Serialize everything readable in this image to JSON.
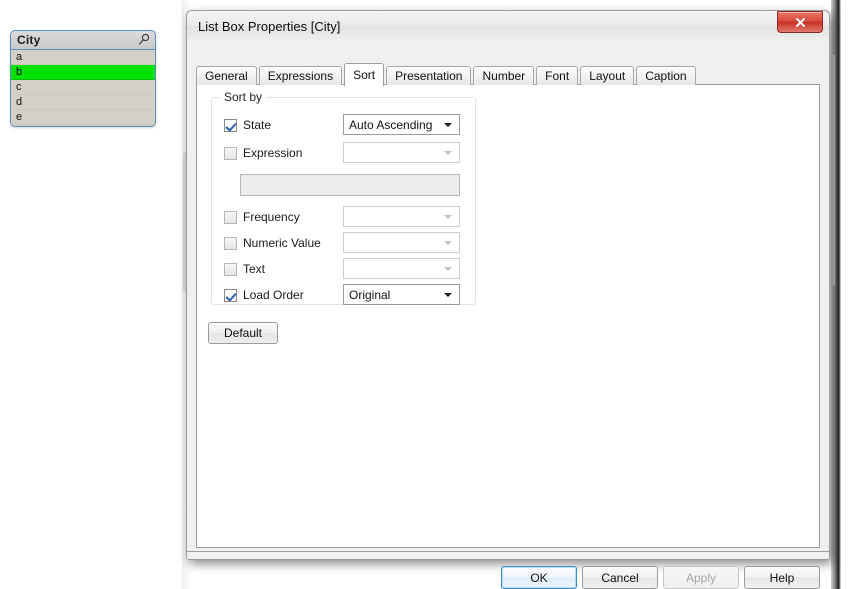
{
  "desktop": {
    "background_color": "#ffffff"
  },
  "listbox_object": {
    "caption": "City",
    "search_icon": "magnifier-icon",
    "selected_color": "#00e200",
    "background_color": "#d4d0c8",
    "border_color": "#5a8fc0",
    "rows": [
      {
        "label": "a",
        "selected": false
      },
      {
        "label": "b",
        "selected": true
      },
      {
        "label": "c",
        "selected": false
      },
      {
        "label": "d",
        "selected": false
      },
      {
        "label": "e",
        "selected": false
      }
    ]
  },
  "dialog": {
    "title": "List Box Properties [City]",
    "close_icon": "close-x-icon",
    "close_color": "#c62f22",
    "tabs": [
      {
        "label": "General",
        "active": false
      },
      {
        "label": "Expressions",
        "active": false
      },
      {
        "label": "Sort",
        "active": true
      },
      {
        "label": "Presentation",
        "active": false
      },
      {
        "label": "Number",
        "active": false
      },
      {
        "label": "Font",
        "active": false
      },
      {
        "label": "Layout",
        "active": false
      },
      {
        "label": "Caption",
        "active": false
      }
    ],
    "sort_tab": {
      "group_legend": "Sort by",
      "rows": [
        {
          "label": "State",
          "checked": true,
          "combo_value": "Auto Ascending",
          "combo_enabled": true
        },
        {
          "label": "Expression",
          "checked": false,
          "combo_value": "",
          "combo_enabled": false
        },
        {
          "label": "Frequency",
          "checked": false,
          "combo_value": "",
          "combo_enabled": false
        },
        {
          "label": "Numeric Value",
          "checked": false,
          "combo_value": "",
          "combo_enabled": false
        },
        {
          "label": "Text",
          "checked": false,
          "combo_value": "",
          "combo_enabled": false
        },
        {
          "label": "Load Order",
          "checked": true,
          "combo_value": "Original",
          "combo_enabled": true
        }
      ],
      "expression_field_value": "",
      "default_button": "Default"
    },
    "footer": {
      "ok": "OK",
      "cancel": "Cancel",
      "apply": "Apply",
      "help": "Help",
      "apply_enabled": false,
      "ok_is_default": true
    }
  }
}
